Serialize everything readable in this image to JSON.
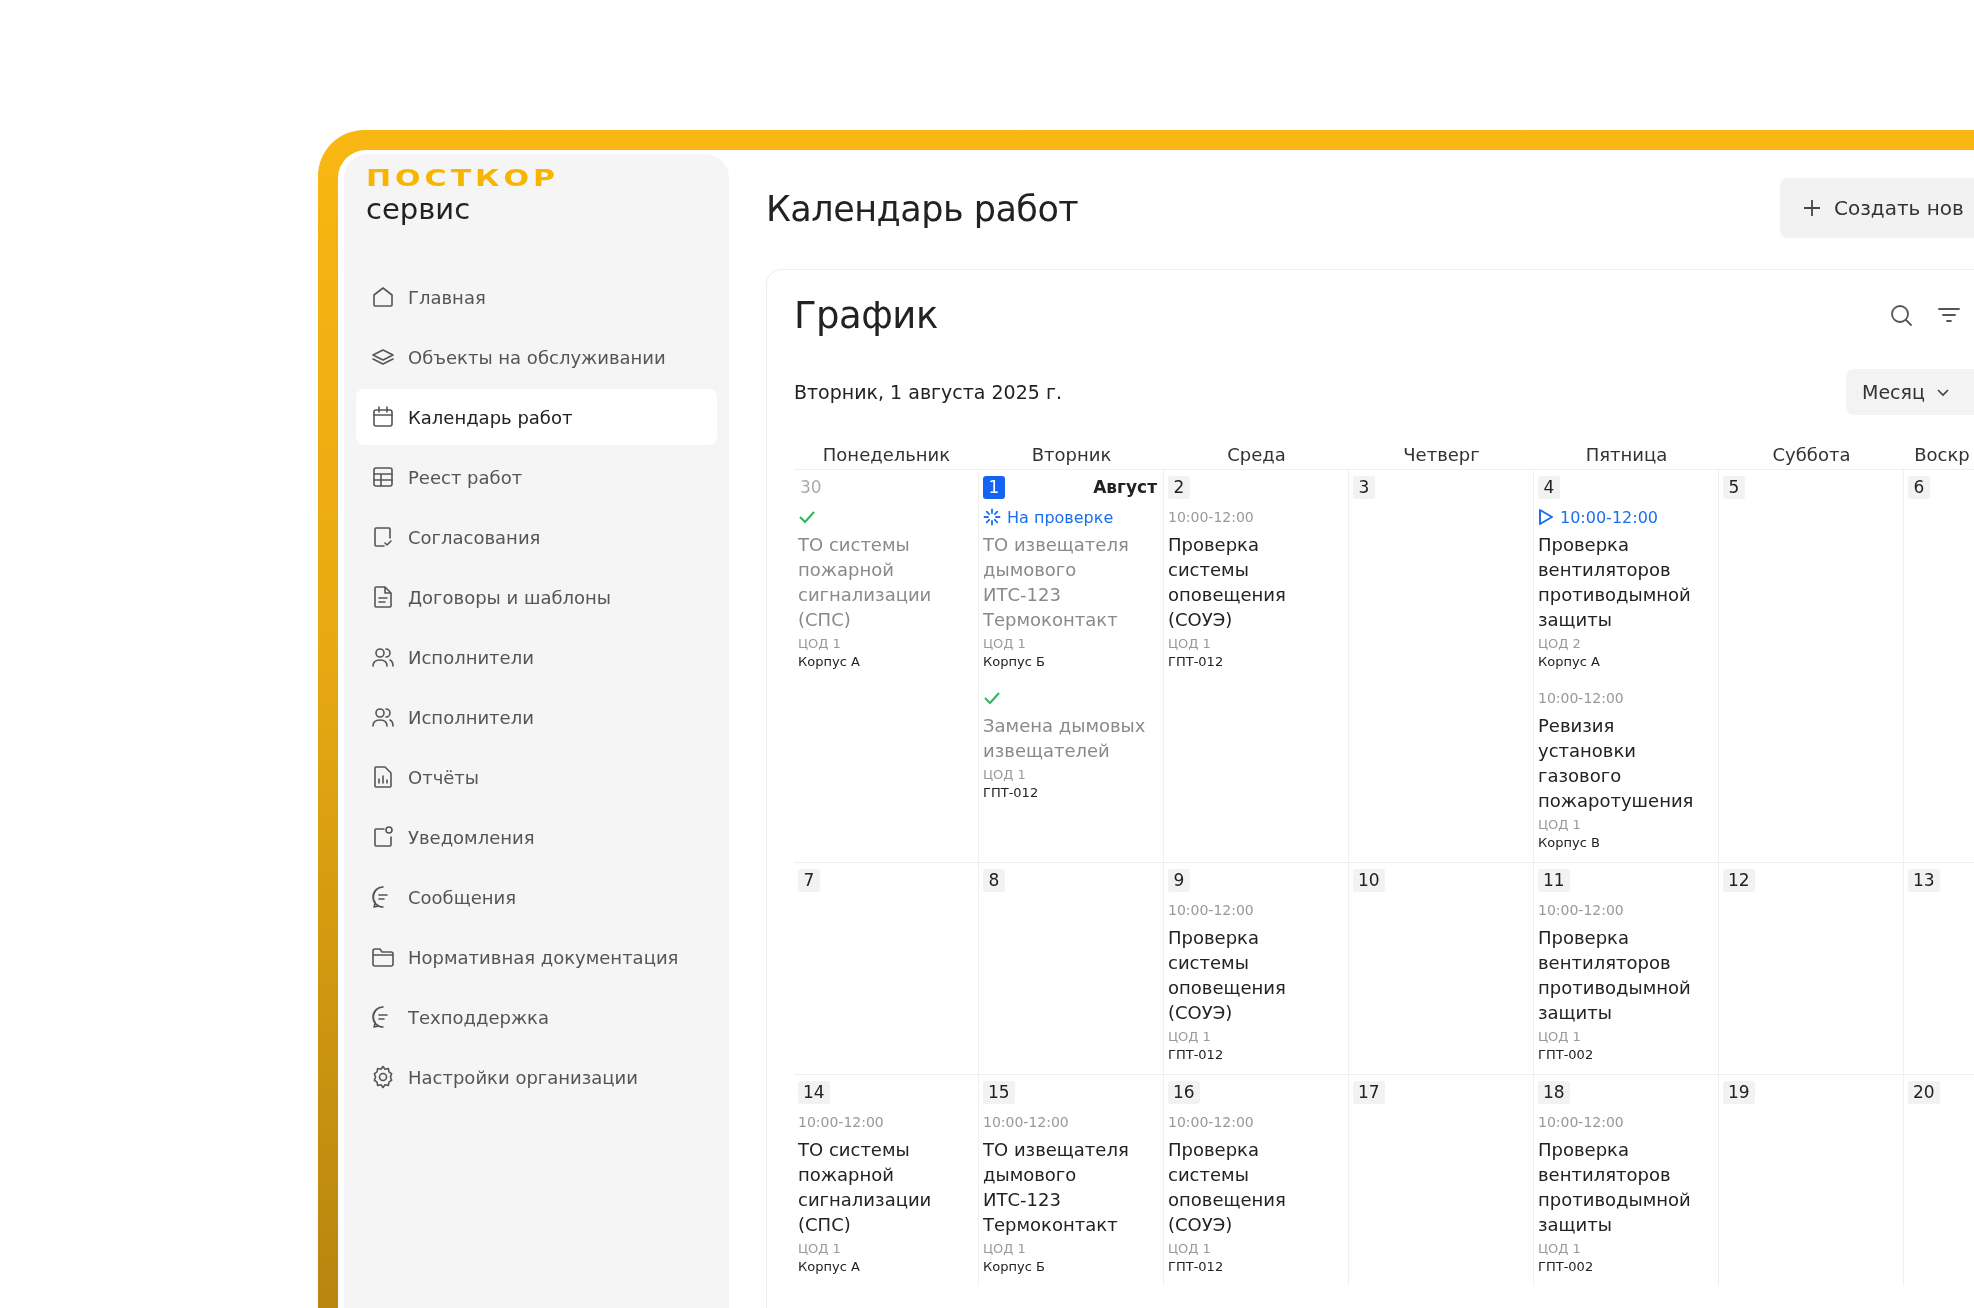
{
  "logo": {
    "brand": "ПОСТКОР",
    "subtitle": "сервис"
  },
  "sidebar": {
    "items": [
      {
        "label": "Главная",
        "selected": false
      },
      {
        "label": "Объекты на обслуживании",
        "selected": false
      },
      {
        "label": "Календарь работ",
        "selected": true
      },
      {
        "label": "Реест работ",
        "selected": false
      },
      {
        "label": "Согласования",
        "selected": false
      },
      {
        "label": "Договоры и шаблоны",
        "selected": false
      },
      {
        "label": "Исполнители",
        "selected": false
      },
      {
        "label": "Исполнители",
        "selected": false
      },
      {
        "label": "Отчёты",
        "selected": false
      },
      {
        "label": "Уведомления",
        "selected": false
      },
      {
        "label": "Сообщения",
        "selected": false
      },
      {
        "label": "Нормативная документация",
        "selected": false
      },
      {
        "label": "Техподдержка",
        "selected": false
      },
      {
        "label": "Настройки организации",
        "selected": false
      }
    ]
  },
  "page": {
    "title": "Календарь работ",
    "create_button": "Создать нов"
  },
  "schedule": {
    "title": "График",
    "current_date": "Вторник, 1 августа 2025 г.",
    "view_select": "Месяц",
    "weekdays": [
      "Понедельник",
      "Вторник",
      "Среда",
      "Четверг",
      "Пятница",
      "Суббота",
      "Воскр"
    ],
    "weeks": [
      {
        "days": [
          {
            "day": "30",
            "today": false,
            "other_month": true,
            "events": [
              {
                "kind": "done",
                "title": "ТО системы пожарной сигнализации (СПС)",
                "place": "ЦОД 1",
                "object": "Корпус А"
              }
            ]
          },
          {
            "day": "1",
            "today": true,
            "other_month": false,
            "month_label": "Август",
            "events": [
              {
                "kind": "review",
                "status_label": "На проверке",
                "title": "ТО извещателя дымового ИТС-123 Термоконтакт",
                "place": "ЦОД 1",
                "object": "Корпус Б"
              },
              {
                "kind": "done",
                "title": "Замена дымовых извещателей",
                "place": "ЦОД 1",
                "object": "ГПТ-012"
              }
            ]
          },
          {
            "day": "2",
            "today": false,
            "other_month": false,
            "events": [
              {
                "kind": "planned",
                "time": "10:00-12:00",
                "title": "Проверка системы оповещения (СОУЭ)",
                "place": "ЦОД 1",
                "object": "ГПТ-012"
              }
            ]
          },
          {
            "day": "3",
            "today": false,
            "other_month": false
          },
          {
            "day": "4",
            "today": false,
            "other_month": false,
            "events": [
              {
                "kind": "active",
                "time": "10:00-12:00",
                "title": "Проверка вентиляторов противодымной защиты",
                "place": "ЦОД 2",
                "object": "Корпус А"
              },
              {
                "kind": "planned",
                "time": "10:00-12:00",
                "title": "Ревизия установки газового пожаротушения",
                "place": "ЦОД 1",
                "object": "Корпус В"
              }
            ]
          },
          {
            "day": "5",
            "today": false,
            "other_month": false
          },
          {
            "day": "6",
            "today": false,
            "other_month": false
          }
        ]
      },
      {
        "days": [
          {
            "day": "7",
            "today": false,
            "other_month": false
          },
          {
            "day": "8",
            "today": false,
            "other_month": false
          },
          {
            "day": "9",
            "today": false,
            "other_month": false,
            "events": [
              {
                "kind": "planned",
                "time": "10:00-12:00",
                "title": "Проверка системы оповещения (СОУЭ)",
                "place": "ЦОД 1",
                "object": "ГПТ-012"
              }
            ]
          },
          {
            "day": "10",
            "today": false,
            "other_month": false
          },
          {
            "day": "11",
            "today": false,
            "other_month": false,
            "events": [
              {
                "kind": "planned",
                "time": "10:00-12:00",
                "title": "Проверка вентиляторов противодымной защиты",
                "place": "ЦОД 1",
                "object": "ГПТ-002"
              }
            ]
          },
          {
            "day": "12",
            "today": false,
            "other_month": false
          },
          {
            "day": "13",
            "today": false,
            "other_month": false
          }
        ]
      },
      {
        "days": [
          {
            "day": "14",
            "today": false,
            "other_month": false,
            "events": [
              {
                "kind": "planned",
                "time": "10:00-12:00",
                "title": "ТО системы пожарной сигнализации (СПС)",
                "place": "ЦОД 1",
                "object": "Корпус А"
              }
            ]
          },
          {
            "day": "15",
            "today": false,
            "other_month": false,
            "events": [
              {
                "kind": "planned",
                "time": "10:00-12:00",
                "title": "ТО извещателя дымового ИТС-123 Термоконтакт",
                "place": "ЦОД 1",
                "object": "Корпус Б"
              }
            ]
          },
          {
            "day": "16",
            "today": false,
            "other_month": false,
            "events": [
              {
                "kind": "planned",
                "time": "10:00-12:00",
                "title": "Проверка системы оповещения (СОУЭ)",
                "place": "ЦОД 1",
                "object": "ГПТ-012"
              }
            ]
          },
          {
            "day": "17",
            "today": false,
            "other_month": false
          },
          {
            "day": "18",
            "today": false,
            "other_month": false,
            "events": [
              {
                "kind": "planned",
                "time": "10:00-12:00",
                "title": "Проверка вентиляторов противодымной защиты",
                "place": "ЦОД 1",
                "object": "ГПТ-002"
              }
            ]
          },
          {
            "day": "19",
            "today": false,
            "other_month": false
          },
          {
            "day": "20",
            "today": false,
            "other_month": false
          }
        ]
      }
    ]
  }
}
